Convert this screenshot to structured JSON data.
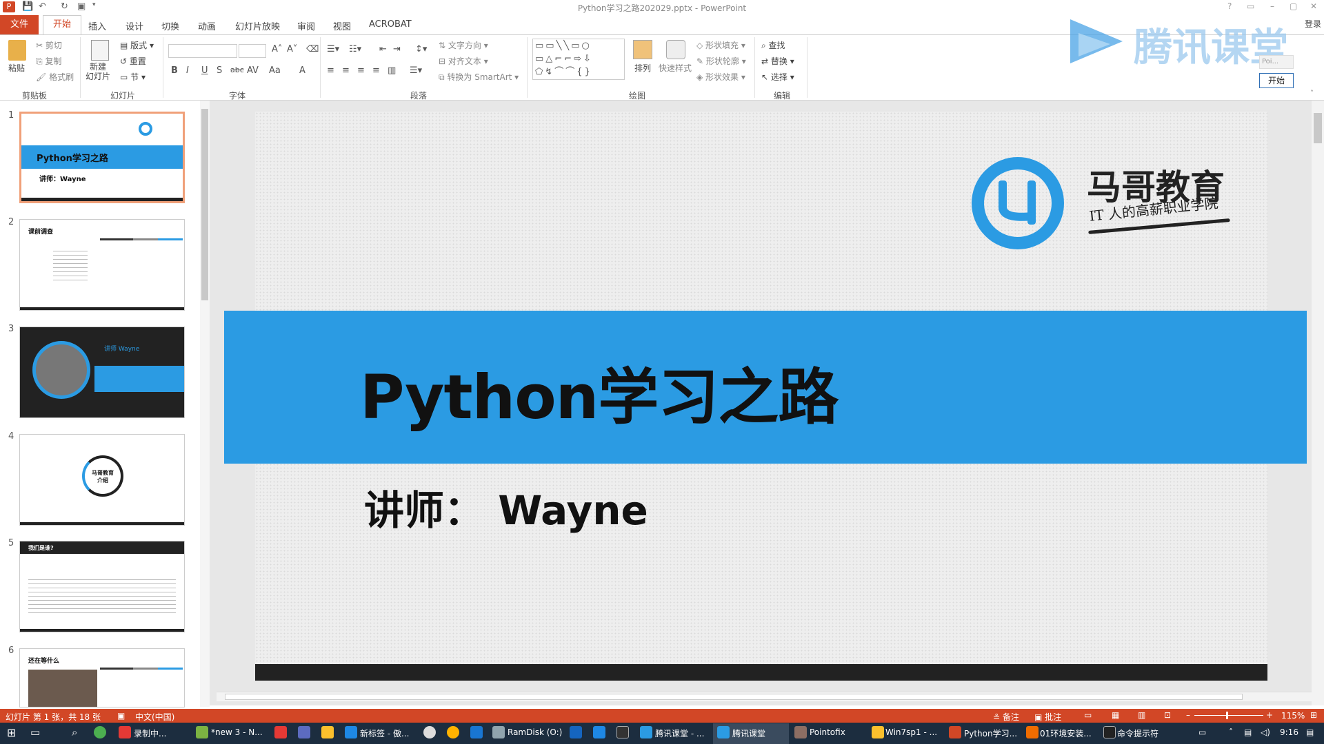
{
  "window": {
    "title": "Python学习之路202029.pptx - PowerPoint",
    "controls": [
      "?",
      "▭",
      "–",
      "▢",
      "✕"
    ],
    "login": "登录"
  },
  "tabs": [
    "文件",
    "开始",
    "插入",
    "设计",
    "切换",
    "动画",
    "幻灯片放映",
    "审阅",
    "视图",
    "ACROBAT"
  ],
  "ribbon": {
    "clipboard": {
      "paste": "粘贴",
      "cut": "剪切",
      "copy": "复制",
      "format": "格式刷",
      "label": "剪贴板"
    },
    "slides": {
      "new": "新建\n幻灯片",
      "layout": "版式",
      "reset": "重置",
      "section": "节",
      "label": "幻灯片"
    },
    "font": {
      "label": "字体",
      "bold": "B",
      "italic": "I",
      "underline": "U",
      "shadow": "S",
      "strike": "abc",
      "spacing": "AV",
      "case": "Aa",
      "color": "A"
    },
    "paragraph": {
      "label": "段落",
      "direction": "文字方向",
      "align": "对齐文本",
      "smartart": "转换为 SmartArt"
    },
    "drawing": {
      "label": "绘图",
      "arrange": "排列",
      "quick": "快速样式",
      "fill": "形状填充",
      "outline": "形状轮廓",
      "effects": "形状效果"
    },
    "editing": {
      "label": "编辑",
      "find": "查找",
      "replace": "替换",
      "select": "选择"
    }
  },
  "watermark": {
    "text": "腾讯课堂"
  },
  "pointofix": {
    "label": "Poi...",
    "start": "开始"
  },
  "thumbnails": [
    {
      "num": "1",
      "title": "Python学习之路",
      "sub": "讲师：Wayne"
    },
    {
      "num": "2",
      "title": "课前调查"
    },
    {
      "num": "3",
      "title": "讲师 Wayne"
    },
    {
      "num": "4",
      "title": "马哥教育\n介绍"
    },
    {
      "num": "5",
      "title": "我们是谁?"
    },
    {
      "num": "6",
      "title": "还在等什么"
    }
  ],
  "slide": {
    "logo_name": "马哥教育",
    "logo_slogan": "IT 人的高薪职业学院",
    "title": "Python学习之路",
    "subtitle": "讲师：  Wayne"
  },
  "status": {
    "slide_info": "幻灯片 第 1 张，共 18 张",
    "language": "中文(中国)",
    "notes": "备注",
    "comments": "批注",
    "zoom": "115%"
  },
  "taskbar": {
    "time": "9:16",
    "apps": [
      "录制中...",
      "*new 3 - N...",
      "新标签 - 傲...",
      "RamDisk (O:)",
      "腾讯课堂 - ...",
      "腾讯课堂",
      "Pointofix",
      "Win7sp1 - ...",
      "Python学习...",
      "01环境安装...",
      "命令提示符"
    ]
  }
}
